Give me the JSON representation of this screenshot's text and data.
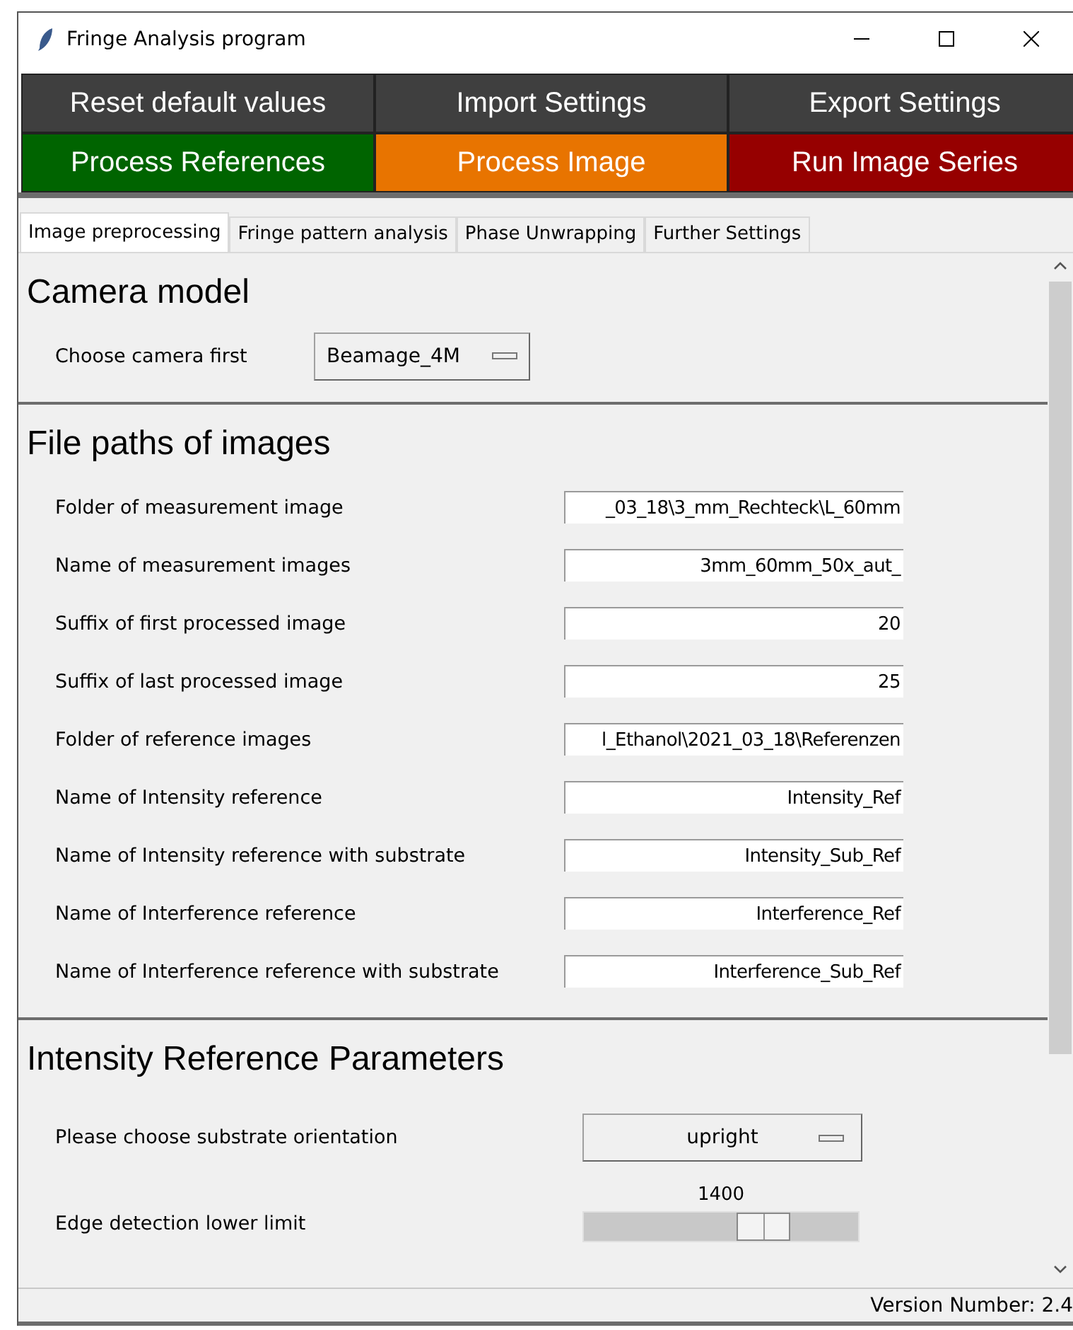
{
  "window": {
    "title": "Fringe Analysis program"
  },
  "action_buttons": [
    {
      "label": "Reset default values",
      "color": "#3f3f3f"
    },
    {
      "label": "Import Settings",
      "color": "#3f3f3f"
    },
    {
      "label": "Export Settings",
      "color": "#3f3f3f"
    },
    {
      "label": "Process References",
      "color": "#006400"
    },
    {
      "label": "Process Image",
      "color": "#e87400"
    },
    {
      "label": "Run Image Series",
      "color": "#960000"
    }
  ],
  "tabs": [
    {
      "label": "Image preprocessing",
      "selected": true
    },
    {
      "label": "Fringe pattern analysis",
      "selected": false
    },
    {
      "label": "Phase Unwrapping",
      "selected": false
    },
    {
      "label": "Further Settings",
      "selected": false
    }
  ],
  "sections": [
    {
      "title": "Camera model",
      "rows": [
        {
          "kind": "dropdown",
          "label": "Choose camera first",
          "value": "Beamage_4M"
        }
      ]
    },
    {
      "title": "File paths of images",
      "rows": [
        {
          "kind": "field",
          "label": "Folder of measurement image",
          "value": "_03_18\\3_mm_Rechteck\\L_60mm"
        },
        {
          "kind": "field",
          "label": "Name of measurement images",
          "value": "3mm_60mm_50x_aut_"
        },
        {
          "kind": "field",
          "label": "Suffix of first processed image",
          "value": "20"
        },
        {
          "kind": "field",
          "label": "Suffix of last processed image",
          "value": "25"
        },
        {
          "kind": "field",
          "label": "Folder of reference images",
          "value": "l_Ethanol\\2021_03_18\\Referenzen"
        },
        {
          "kind": "field",
          "label": "Name of Intensity reference",
          "value": "Intensity_Ref"
        },
        {
          "kind": "field",
          "label": "Name of Intensity reference with substrate",
          "value": "Intensity_Sub_Ref"
        },
        {
          "kind": "field",
          "label": "Name of Interference reference",
          "value": "Interference_Ref"
        },
        {
          "kind": "field",
          "label": "Name of Interference reference with substrate",
          "value": "Interference_Sub_Ref"
        }
      ]
    },
    {
      "title": "Intensity Reference Parameters",
      "rows": [
        {
          "kind": "dropdown",
          "label": "Please choose substrate orientation",
          "value": "upright"
        },
        {
          "kind": "slider",
          "label": "Edge detection lower limit",
          "reading": "1400",
          "level": 0.69
        }
      ]
    }
  ],
  "status_bar": {
    "text": "Version Number: 2.4"
  }
}
